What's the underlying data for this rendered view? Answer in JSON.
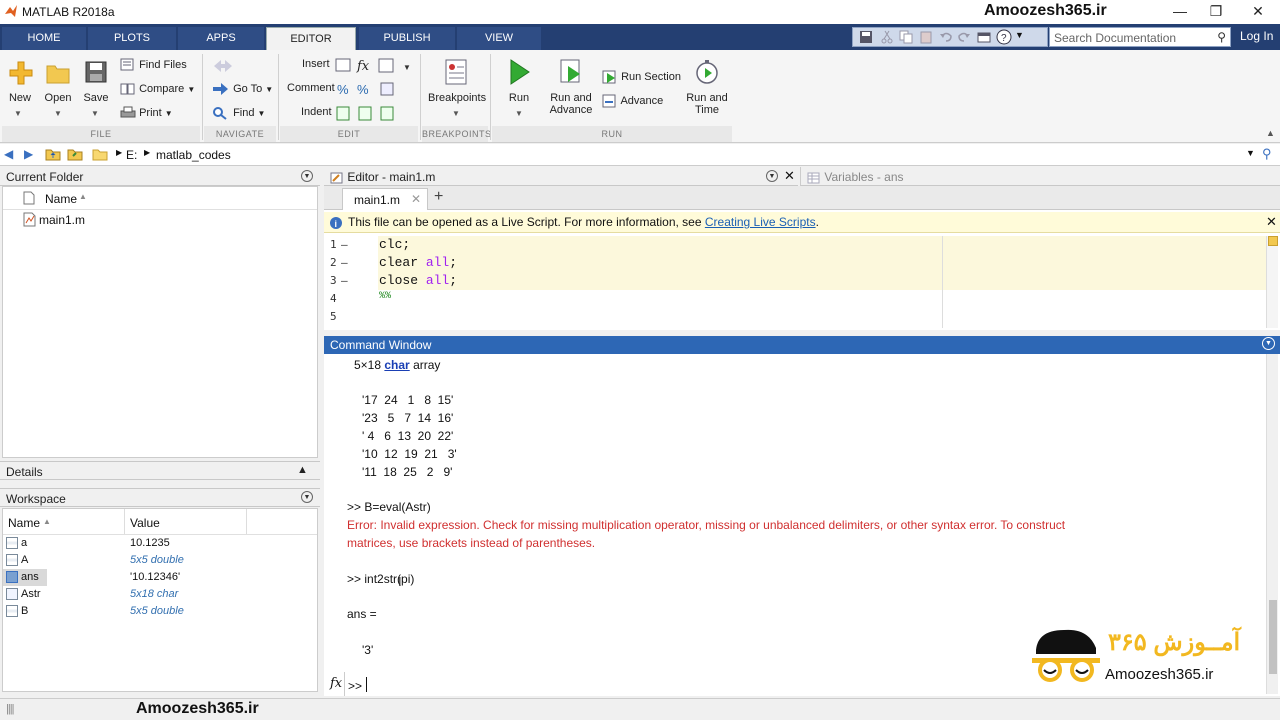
{
  "window": {
    "title": "MATLAB R2018a",
    "watermark": "Amoozesh365.ir"
  },
  "tabs": [
    {
      "label": "HOME"
    },
    {
      "label": "PLOTS"
    },
    {
      "label": "APPS"
    },
    {
      "label": "EDITOR",
      "active": true
    },
    {
      "label": "PUBLISH"
    },
    {
      "label": "VIEW"
    }
  ],
  "search": {
    "placeholder": "Search Documentation"
  },
  "login": "Log In",
  "ribbon": {
    "file": {
      "new": "New",
      "open": "Open",
      "save": "Save",
      "find_files": "Find Files",
      "compare": "Compare",
      "print": "Print",
      "section": "FILE"
    },
    "navigate": {
      "goto": "Go To",
      "find": "Find",
      "section": "NAVIGATE"
    },
    "edit": {
      "insert": "Insert",
      "comment": "Comment",
      "indent": "Indent",
      "section": "EDIT"
    },
    "breakpoints": {
      "label": "Breakpoints",
      "section": "BREAKPOINTS"
    },
    "run": {
      "run": "Run",
      "run_advance_1": "Run and",
      "run_advance_2": "Advance",
      "run_section": "Run Section",
      "advance": "Advance",
      "run_time_1": "Run and",
      "run_time_2": "Time",
      "section": "RUN"
    }
  },
  "address": {
    "drive": "E:",
    "folder": "matlab_codes"
  },
  "current_folder": {
    "title": "Current Folder",
    "col_name": "Name",
    "files": [
      "main1.m"
    ]
  },
  "details": {
    "title": "Details"
  },
  "workspace": {
    "title": "Workspace",
    "col_name": "Name",
    "col_value": "Value",
    "rows": [
      {
        "name": "a",
        "value": "10.1235",
        "italic": false
      },
      {
        "name": "A",
        "value": "5x5 double",
        "italic": true
      },
      {
        "name": "ans",
        "value": "'10.12346'",
        "italic": false
      },
      {
        "name": "Astr",
        "value": "5x18 char",
        "italic": true
      },
      {
        "name": "B",
        "value": "5x5 double",
        "italic": true
      }
    ]
  },
  "editor": {
    "title": "Editor - main1.m",
    "variables_title": "Variables - ans",
    "tab": "main1.m",
    "info": "This file can be opened as a Live Script. For more information, see",
    "info_link": "Creating Live Scripts",
    "info_tail": ".",
    "lines": [
      {
        "num": "1",
        "dash": "–",
        "cmd": "clc;",
        "kw": "",
        "tail": ""
      },
      {
        "num": "2",
        "dash": "–",
        "cmd": "clear ",
        "kw": "all",
        "tail": ";"
      },
      {
        "num": "3",
        "dash": "–",
        "cmd": "close ",
        "kw": "all",
        "tail": ";"
      },
      {
        "num": "4",
        "dash": "",
        "cmd": "",
        "kw": "",
        "tail": "%%"
      },
      {
        "num": "5",
        "dash": "",
        "cmd": "",
        "kw": "",
        "tail": ""
      }
    ]
  },
  "command_window": {
    "title": "Command Window",
    "size_prefix": "5×18 ",
    "size_link": "char",
    "size_suffix": " array",
    "matrix": [
      "'17  24   1   8  15'",
      "'23   5   7  14  16'",
      "' 4   6  13  20  22'",
      "'10  12  19  21   3'",
      "'11  18  25   2   9'"
    ],
    "cmd1": ">> B=eval(Astr)",
    "err1": "Error: Invalid expression. Check for missing multiplication operator, missing or unbalanced delimiters, or other syntax error. To construct",
    "err2": "matrices, use brackets instead of parentheses.",
    "cmd2": ">> int2str(pi)",
    "ans_label": "ans =",
    "ans_value": "'3'",
    "prompt": ">>",
    "fx": "fx"
  },
  "logo": {
    "text": "Amoozesh365.ir",
    "persian": "آمــوزش ۳۶۵"
  },
  "statusbar": {
    "watermark": "Amoozesh365.ir"
  }
}
